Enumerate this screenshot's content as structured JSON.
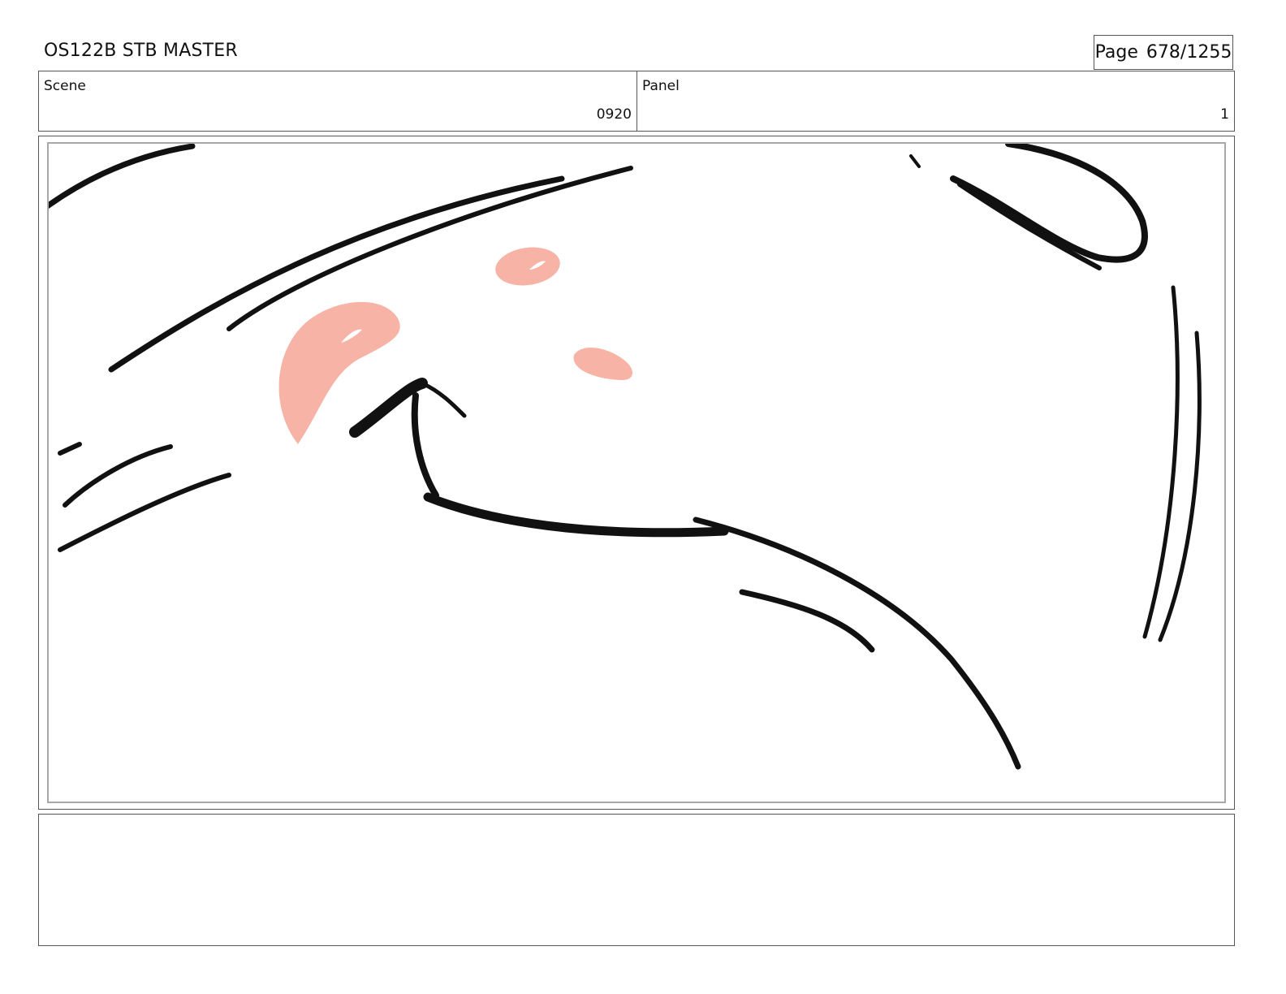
{
  "header": {
    "title": "OS122B STB MASTER",
    "page_label": "Page",
    "page_number": "678/1255"
  },
  "info": {
    "scene_label": "Scene",
    "scene_value": "0920",
    "panel_label": "Panel",
    "panel_value": "1"
  },
  "drawing": {
    "ink_color": "#111111",
    "blush_color": "#f7b3a6"
  },
  "notes": {
    "text": ""
  }
}
